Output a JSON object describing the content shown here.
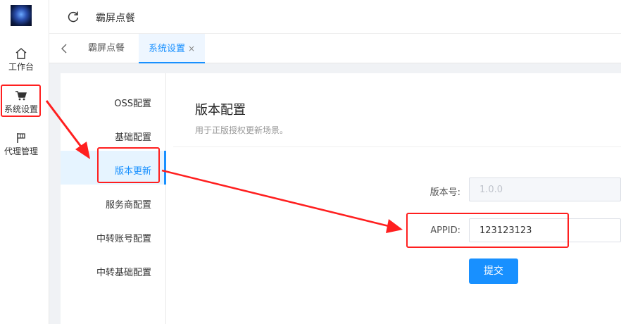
{
  "rail": {
    "items": [
      {
        "label": "工作台",
        "icon": "home-icon"
      },
      {
        "label": "系统设置",
        "icon": "cart-icon"
      },
      {
        "label": "代理管理",
        "icon": "flag-icon"
      }
    ]
  },
  "header": {
    "title": "霸屏点餐"
  },
  "tabs": [
    {
      "label": "霸屏点餐",
      "active": false
    },
    {
      "label": "系统设置",
      "active": true,
      "close": "×"
    }
  ],
  "side_menu": {
    "items": [
      {
        "label": "OSS配置"
      },
      {
        "label": "基础配置"
      },
      {
        "label": "版本更新",
        "active": true
      },
      {
        "label": "服务商配置"
      },
      {
        "label": "中转账号配置"
      },
      {
        "label": "中转基础配置"
      }
    ]
  },
  "main": {
    "title": "版本配置",
    "subtitle": "用于正版授权更新场景。",
    "fields": [
      {
        "label": "版本号:",
        "value": "1.0.0",
        "disabled": true
      },
      {
        "label": "APPID:",
        "value": "123123123",
        "disabled": false
      }
    ],
    "submit_label": "提交"
  },
  "colors": {
    "accent": "#1890ff",
    "annotation": "#ff1f1f"
  }
}
